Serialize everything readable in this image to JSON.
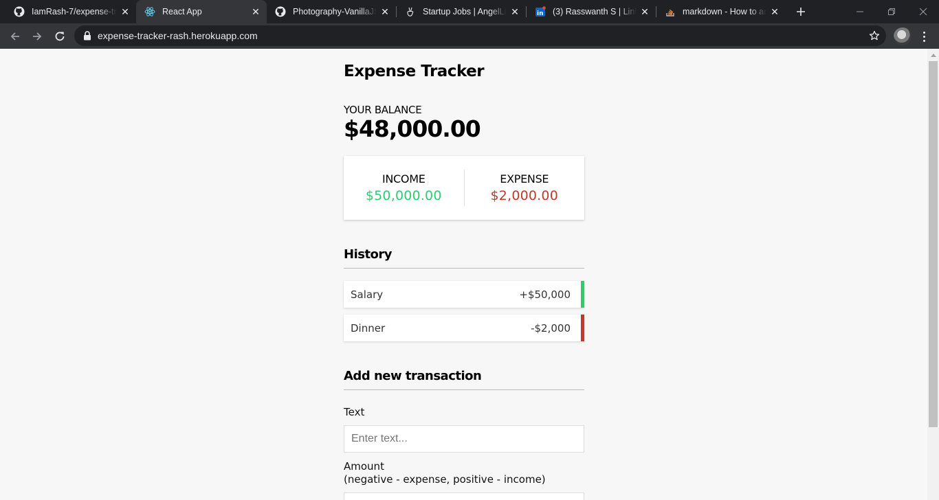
{
  "browser": {
    "tabs": [
      {
        "title": "IamRash-7/expense-tra",
        "icon": "github-icon"
      },
      {
        "title": "React App",
        "icon": "react-icon"
      },
      {
        "title": "Photography-VanillaJS/",
        "icon": "github-icon"
      },
      {
        "title": "Startup Jobs | AngelList",
        "icon": "angellist-icon"
      },
      {
        "title": "(3) Rasswanth S | Linked",
        "icon": "linkedin-icon"
      },
      {
        "title": "markdown - How to add",
        "icon": "stackoverflow-icon"
      }
    ],
    "url": "expense-tracker-rash.herokuapp.com"
  },
  "app": {
    "title": "Expense Tracker",
    "balance_label": "YOUR BALANCE",
    "balance": "$48,000.00",
    "income_label": "INCOME",
    "income": "$50,000.00",
    "expense_label": "EXPENSE",
    "expense": "$2,000.00",
    "history_title": "History",
    "transactions": [
      {
        "text": "Salary",
        "amount": "+$50,000"
      },
      {
        "text": "Dinner",
        "amount": "-$2,000"
      }
    ],
    "add_title": "Add new transaction",
    "text_label": "Text",
    "text_placeholder": "Enter text...",
    "amount_label": "Amount",
    "amount_hint": "(negative - expense, positive - income)"
  },
  "colors": {
    "income": "#2ecc71",
    "expense": "#c0392b"
  }
}
